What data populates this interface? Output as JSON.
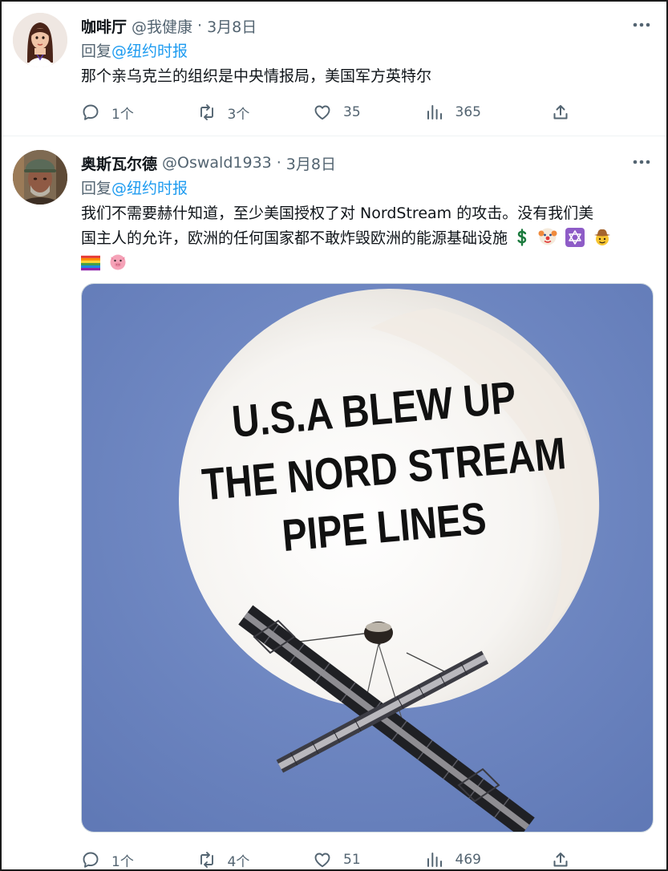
{
  "tweet1": {
    "display_name": "咖啡厅",
    "handle": "@我健康",
    "separator": "·",
    "date": "3月8日",
    "reply_label": "回复",
    "reply_to": "@纽约时报",
    "text": "那个亲乌克兰的组织是中央情报局，美国军方英特尔",
    "replies": "1个",
    "retweets": "3个",
    "likes": "35",
    "views": "365"
  },
  "tweet2": {
    "display_name": "奥斯瓦尔德",
    "handle": "@Oswald1933",
    "separator": "·",
    "date": "3月8日",
    "reply_label": "回复",
    "reply_to": "@纽约时报",
    "text_line1": "我们不需要赫什知道，至少美国授权了对 NordStream 的攻击。没有我们美",
    "text_line2": "国主人的允许，欧洲的任何国家都不敢炸毁欧洲的能源基础设施",
    "emojis": [
      "money-sign",
      "clown-face",
      "star-of-david",
      "cowboy-face",
      "rainbow-flag",
      "pig-face"
    ],
    "image": {
      "line1": "U.S.A BLEW UP",
      "line2": "THE NORD STREAM",
      "line3": "PIPE LINES"
    },
    "replies": "1个",
    "retweets": "4个",
    "likes": "51",
    "views": "469"
  },
  "colors": {
    "link": "#1d9bf0",
    "muted": "#536471",
    "text": "#0f1419",
    "sky": "#6f88c4"
  }
}
